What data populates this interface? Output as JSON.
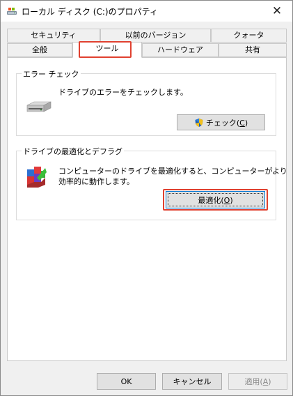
{
  "window": {
    "title": "ローカル ディスク (C:)のプロパティ",
    "close_glyph": "✕"
  },
  "tabs": {
    "row1": [
      {
        "label": "セキュリティ",
        "name": "tab-security"
      },
      {
        "label": "以前のバージョン",
        "name": "tab-previous-versions"
      },
      {
        "label": "クォータ",
        "name": "tab-quota"
      }
    ],
    "row2": [
      {
        "label": "全般",
        "name": "tab-general"
      },
      {
        "label": "ツール",
        "name": "tab-tools",
        "active": true
      },
      {
        "label": "ハードウェア",
        "name": "tab-hardware"
      },
      {
        "label": "共有",
        "name": "tab-sharing"
      }
    ]
  },
  "error_check": {
    "group_title": "エラー チェック",
    "description": "ドライブのエラーをチェックします。",
    "button_label": "チェック(C)",
    "button_prefix": "チェック(",
    "button_accel": "C",
    "button_suffix": ")"
  },
  "optimize": {
    "group_title": "ドライブの最適化とデフラグ",
    "description_line1": "コンピューターのドライブを最適化すると、コンピューターがより",
    "description_line2": "効率的に動作します。",
    "button_prefix": "最適化(",
    "button_accel": "O",
    "button_suffix": ")"
  },
  "footer": {
    "ok_label": "OK",
    "cancel_label": "キャンセル",
    "apply_prefix": "適用(",
    "apply_accel": "A",
    "apply_suffix": ")"
  },
  "colors": {
    "highlight": "#e0402f",
    "window_bg": "#f0f0f0",
    "focus_blue": "#0078d7"
  },
  "icons": {
    "title": "drive-icon",
    "error_check": "hard-disk-icon",
    "shield": "uac-shield-icon",
    "optimize": "defrag-icon"
  }
}
